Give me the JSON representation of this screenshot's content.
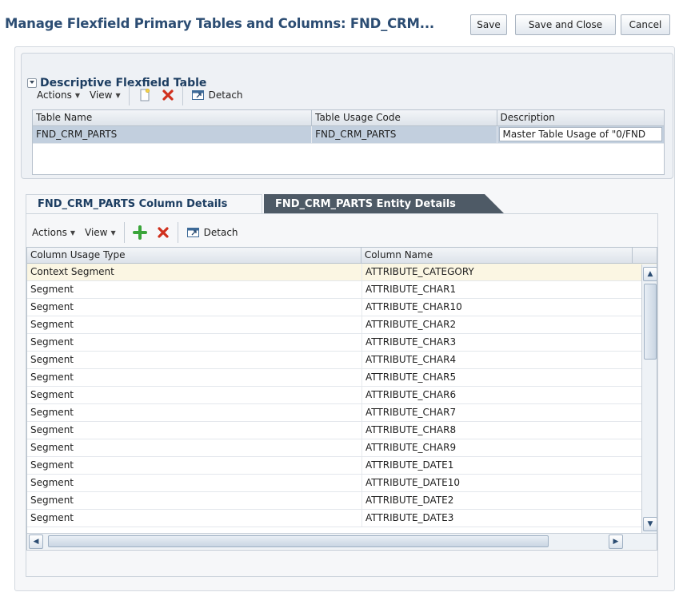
{
  "header": {
    "title": "Manage Flexfield Primary Tables and Columns: FND_CRM...",
    "buttons": {
      "save": "Save",
      "save_close": "Save and Close",
      "cancel": "Cancel"
    }
  },
  "dft_section": {
    "title": "Descriptive Flexfield Table",
    "toolbar": {
      "actions": "Actions",
      "view": "View",
      "detach": "Detach"
    },
    "columns": [
      "Table Name",
      "Table Usage Code",
      "Description"
    ],
    "rows": [
      [
        "FND_CRM_PARTS",
        "FND_CRM_PARTS",
        "Master Table Usage of \"0/FND"
      ]
    ]
  },
  "tabs": {
    "column_details": "FND_CRM_PARTS Column Details",
    "entity_details": "FND_CRM_PARTS Entity Details"
  },
  "column_section": {
    "toolbar": {
      "actions": "Actions",
      "view": "View",
      "detach": "Detach"
    },
    "columns": [
      "Column Usage Type",
      "Column Name"
    ],
    "rows": [
      [
        "Context Segment",
        "ATTRIBUTE_CATEGORY"
      ],
      [
        "Segment",
        "ATTRIBUTE_CHAR1"
      ],
      [
        "Segment",
        "ATTRIBUTE_CHAR10"
      ],
      [
        "Segment",
        "ATTRIBUTE_CHAR2"
      ],
      [
        "Segment",
        "ATTRIBUTE_CHAR3"
      ],
      [
        "Segment",
        "ATTRIBUTE_CHAR4"
      ],
      [
        "Segment",
        "ATTRIBUTE_CHAR5"
      ],
      [
        "Segment",
        "ATTRIBUTE_CHAR6"
      ],
      [
        "Segment",
        "ATTRIBUTE_CHAR7"
      ],
      [
        "Segment",
        "ATTRIBUTE_CHAR8"
      ],
      [
        "Segment",
        "ATTRIBUTE_CHAR9"
      ],
      [
        "Segment",
        "ATTRIBUTE_DATE1"
      ],
      [
        "Segment",
        "ATTRIBUTE_DATE10"
      ],
      [
        "Segment",
        "ATTRIBUTE_DATE2"
      ],
      [
        "Segment",
        "ATTRIBUTE_DATE3"
      ]
    ]
  },
  "colors": {
    "title": "#2c4d73",
    "selected_row": "#c2cfde",
    "highlight_row": "#fbf6e3",
    "delete_icon": "#d0301d",
    "add_icon": "#3aa53a"
  }
}
